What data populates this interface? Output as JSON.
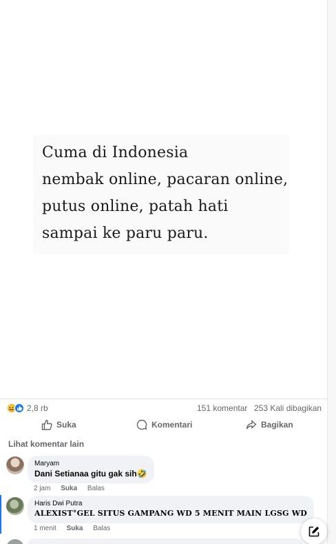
{
  "post": {
    "quote_lines": [
      "Cuma di Indonesia",
      "nembak online, pacaran online,",
      "putus  online, patah hati",
      "sampai ke paru paru."
    ]
  },
  "stats": {
    "reactions_count": "2,8 rb",
    "comments": "151 komentar",
    "shares": "253 Kali dibagikan",
    "reaction_icons": [
      "haha-icon",
      "like-icon"
    ]
  },
  "actions": {
    "like": "Suka",
    "comment": "Komentari",
    "share": "Bagikan"
  },
  "more_comments": "Lihat komentar lain",
  "comments": [
    {
      "author": "Maryam",
      "text": "Dani Setianaa gitu gak sih🤣",
      "time": "2 jam",
      "like": "Suka",
      "reply": "Balas"
    },
    {
      "author": "Haris Dwi Putra",
      "text": "ALEXIST°GEL SITUS GAMPANG WD 5 MENIT MAIN LGSG WD",
      "time": "1 menit",
      "like": "Suka",
      "reply": "Balas"
    }
  ],
  "colors": {
    "accent": "#1877f2",
    "muted": "#65676b",
    "bubble": "#f0f2f5"
  }
}
